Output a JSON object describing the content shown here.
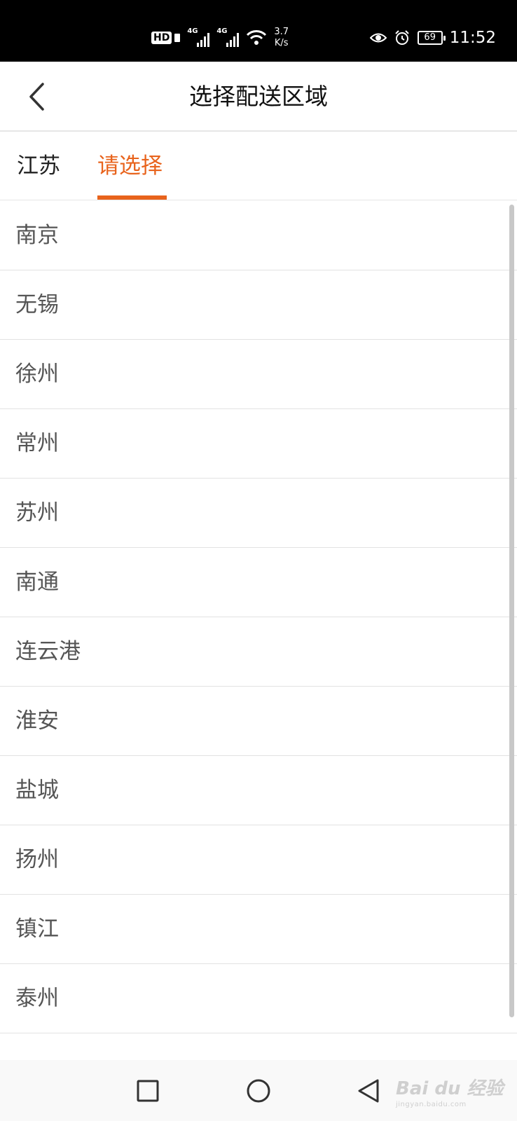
{
  "status_bar": {
    "hd": "HD",
    "signal1": "4G",
    "signal2": "4G",
    "speed_value": "3.7",
    "speed_unit": "K/s",
    "battery": "69",
    "time": "11:52"
  },
  "header": {
    "title": "选择配送区域"
  },
  "tabs": {
    "province": "江苏",
    "city": "请选择",
    "active_color": "#e8631c"
  },
  "cities": [
    "南京",
    "无锡",
    "徐州",
    "常州",
    "苏州",
    "南通",
    "连云港",
    "淮安",
    "盐城",
    "扬州",
    "镇江",
    "泰州"
  ],
  "watermark": {
    "main": "Bai du 经验",
    "sub": "jingyan.baidu.com"
  },
  "icons": {
    "back": "chevron-left-icon",
    "recents": "square-icon",
    "home": "circle-icon",
    "back_nav": "triangle-back-icon"
  }
}
